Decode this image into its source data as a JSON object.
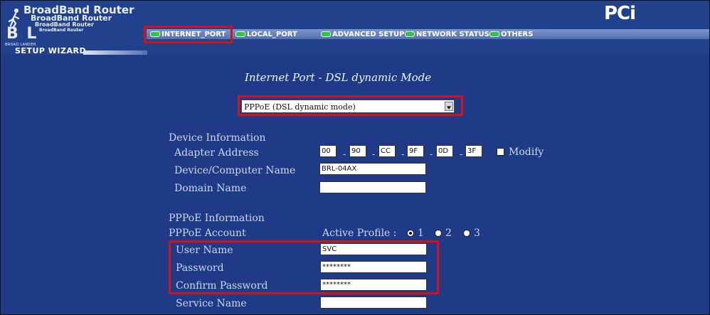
{
  "header": {
    "router_titles": [
      "BroadBand Router",
      "BroadBand Router",
      "BroadBand Router",
      "BroadBand Router"
    ],
    "logo_mark": "B L",
    "logo_tagline": "BROAD LANDER",
    "setup_wizard": "SETUP WIZARD",
    "brand": "PCi"
  },
  "tabs": [
    {
      "label": "INTERNET_PORT",
      "active": true
    },
    {
      "label": "LOCAL_PORT",
      "active": false
    },
    {
      "label": "ADVANCED SETUP",
      "active": false
    },
    {
      "label": "NETWORK STATUS",
      "active": false
    },
    {
      "label": "OTHERS",
      "active": false
    }
  ],
  "page": {
    "title": "Internet Port - DSL dynamic Mode",
    "mode_select": "PPPoE (DSL dynamic mode)"
  },
  "device_info": {
    "heading": "Device Information",
    "adapter_label": "Adapter Address",
    "mac": [
      "00",
      "90",
      "CC",
      "9F",
      "0D",
      "3F"
    ],
    "modify_label": "Modify",
    "modify_checked": false,
    "device_name_label": "Device/Computer Name",
    "device_name": "BRL-04AX",
    "domain_label": "Domain Name",
    "domain_name": ""
  },
  "pppoe": {
    "heading": "PPPoE Information",
    "account_label": "PPPoE Account",
    "active_profile_label": "Active Profile :",
    "profiles": [
      "1",
      "2",
      "3"
    ],
    "active_profile": "1",
    "user_label": "User Name",
    "user_name": "SVC",
    "password_label": "Password",
    "password": "********",
    "confirm_label": "Confirm Password",
    "confirm_password": "********",
    "service_label": "Service Name",
    "service_name": ""
  },
  "colors": {
    "background": "#1f3a86",
    "highlight": "#d1131d",
    "led": "#32c24a"
  }
}
